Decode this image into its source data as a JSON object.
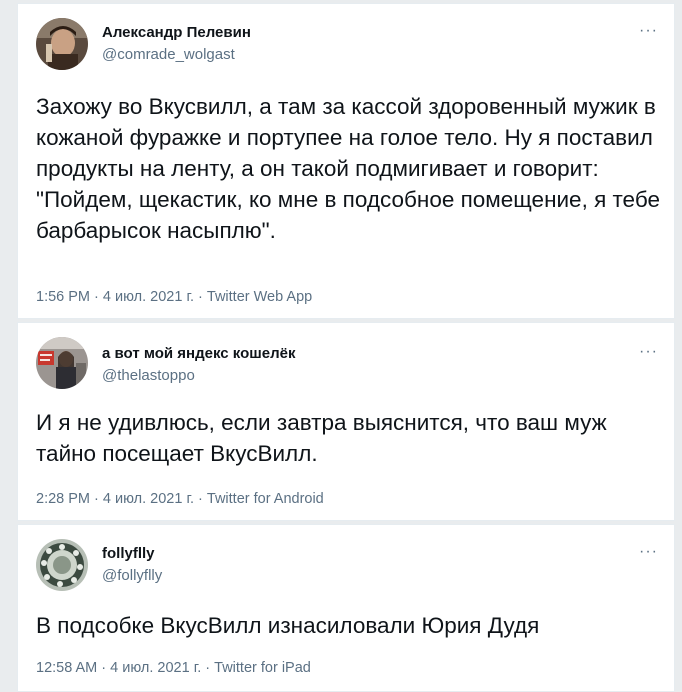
{
  "tweets": [
    {
      "name": "Александр Пелевин",
      "handle": "@comrade_wolgast",
      "more": "···",
      "text": "Захожу во Вкусвилл, а там за кассой здоровенный мужик в кожаной фуражке и портупее на голое тело. Ну я поставил продукты на ленту, а он такой подмигивает и говорит: \"Пойдем, щекастик, ко мне в подсобное помещение, я тебе барбарысок насыплю\".",
      "time": "1:56 PM",
      "date": "4 июл. 2021 г.",
      "source": "Twitter Web App"
    },
    {
      "name": "а вот мой яндекс кошелёк",
      "handle": "@thelastoppo",
      "more": "···",
      "text": "И я не удивлюсь, если завтра выяснится, что ваш муж тайно посещает ВкусВилл.",
      "time": "2:28 PM",
      "date": "4 июл. 2021 г.",
      "source": "Twitter for Android"
    },
    {
      "name": "follyflly",
      "handle": "@follyflly",
      "more": "···",
      "text": "В подсобке ВкусВилл изнасиловали Юрия Дудя",
      "time": "12:58 AM",
      "date": "4 июл. 2021 г.",
      "source": "Twitter for iPad"
    }
  ],
  "separator": " · "
}
